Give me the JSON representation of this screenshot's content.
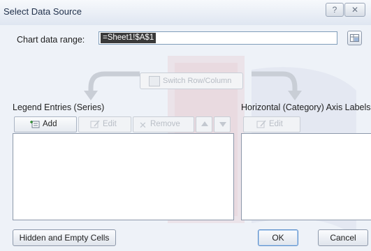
{
  "window": {
    "title": "Select Data Source",
    "help_label": "?",
    "close_label": "✕"
  },
  "range": {
    "label": "Chart data range:",
    "value": "=Sheet1!$A$1",
    "collapse_icon": "range-selector-icon"
  },
  "switch": {
    "label": "Switch Row/Column"
  },
  "legend": {
    "section_label": "Legend Entries (Series)",
    "add_label": "Add",
    "edit_label": "Edit",
    "remove_label": "Remove",
    "up_icon": "move-up-icon",
    "down_icon": "move-down-icon"
  },
  "axis": {
    "section_label": "Horizontal (Category) Axis Labels",
    "edit_label": "Edit"
  },
  "footer": {
    "hidden_label": "Hidden and Empty Cells",
    "ok_label": "OK",
    "cancel_label": "Cancel"
  },
  "colors": {
    "accent": "#3a3a3a",
    "watermark": "#c8323c",
    "watermark_blue": "#3c5a9c"
  }
}
